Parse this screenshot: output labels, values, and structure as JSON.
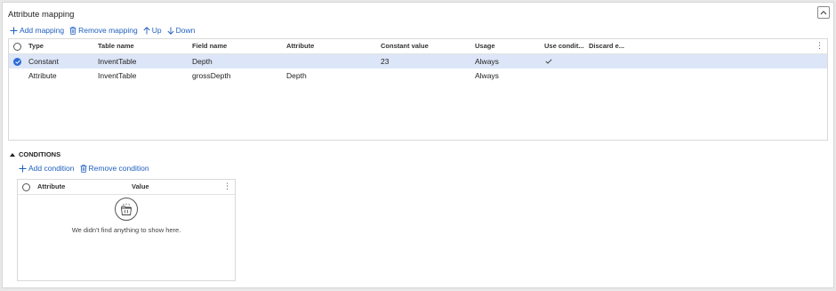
{
  "panel": {
    "title": "Attribute mapping",
    "collapse_icon": "chevron-up-icon"
  },
  "toolbar": {
    "add_mapping": "Add mapping",
    "remove_mapping": "Remove mapping",
    "up": "Up",
    "down": "Down"
  },
  "mapping_grid": {
    "columns": [
      "Type",
      "Table name",
      "Field name",
      "Attribute",
      "Constant value",
      "Usage",
      "Use condit...",
      "Discard e..."
    ],
    "rows": [
      {
        "type": "Constant",
        "table_name": "InventTable",
        "field_name": "Depth",
        "attribute": "",
        "constant_value": "23",
        "usage": "Always",
        "use_condition": true,
        "selected": true
      },
      {
        "type": "Attribute",
        "table_name": "InventTable",
        "field_name": "grossDepth",
        "attribute": "Depth",
        "constant_value": "",
        "usage": "Always",
        "use_condition": false,
        "selected": false
      }
    ]
  },
  "conditions": {
    "heading": "CONDITIONS",
    "add_condition": "Add condition",
    "remove_condition": "Remove condition",
    "columns": [
      "Attribute",
      "Value"
    ],
    "empty_message": "We didn't find anything to show here."
  },
  "colors": {
    "accent": "#1f5fbf",
    "selected_row": "#dde6f8",
    "check_fill": "#2c6bd6"
  }
}
